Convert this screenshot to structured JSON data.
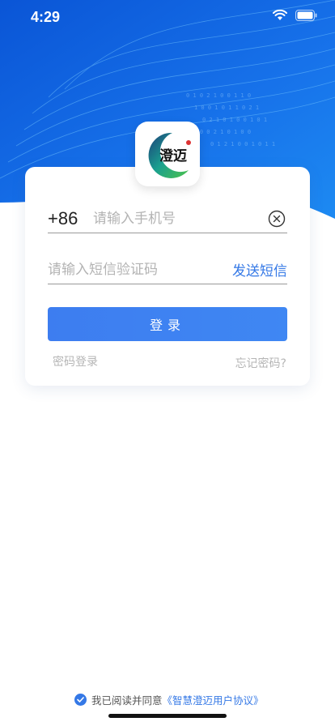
{
  "status_bar": {
    "time": "4:29",
    "icons": [
      "wifi-icon",
      "battery-icon"
    ]
  },
  "logo": {
    "alt_text": "澄迈"
  },
  "login_form": {
    "country_code": "+86",
    "phone_placeholder": "请输入手机号",
    "phone_value": "",
    "code_placeholder": "请输入短信验证码",
    "code_value": "",
    "send_code_label": "发送短信",
    "login_label": "登录",
    "password_login_label": "密码登录",
    "forgot_password_label": "忘记密码?"
  },
  "agreement": {
    "prefix": "我已阅读并同意",
    "link": "《智慧澄迈用户协议》",
    "checked": true
  },
  "colors": {
    "accent": "#3478e6",
    "hero_blue": "#1565e0"
  }
}
